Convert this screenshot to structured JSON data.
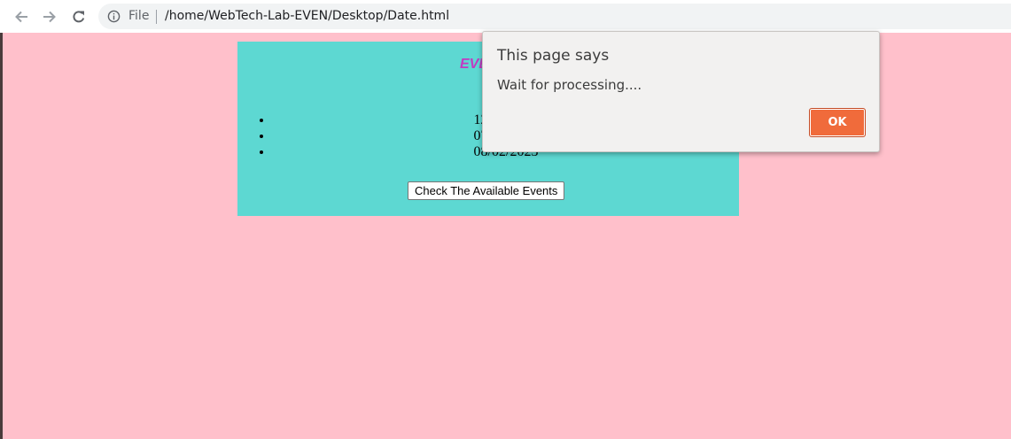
{
  "browser": {
    "scheme_label": "File",
    "url": "/home/WebTech-Lab-EVEN/Desktop/Date.html",
    "icons": {
      "back": "arrow-left",
      "forward": "arrow-right",
      "reload": "reload",
      "site_info": "info-circle"
    }
  },
  "page": {
    "background_color": "#ffc0cb",
    "panel_color": "#5dd8d2",
    "title": "EVENTS",
    "title_color": "#c13bc1",
    "events": [
      "12/12/2020",
      "07/12/2022",
      "08/02/2023"
    ],
    "check_button_label": "Check The Available Events"
  },
  "dialog": {
    "title": "This page says",
    "message": "Wait for processing....",
    "ok_label": "OK",
    "ok_color": "#f06b3b"
  }
}
